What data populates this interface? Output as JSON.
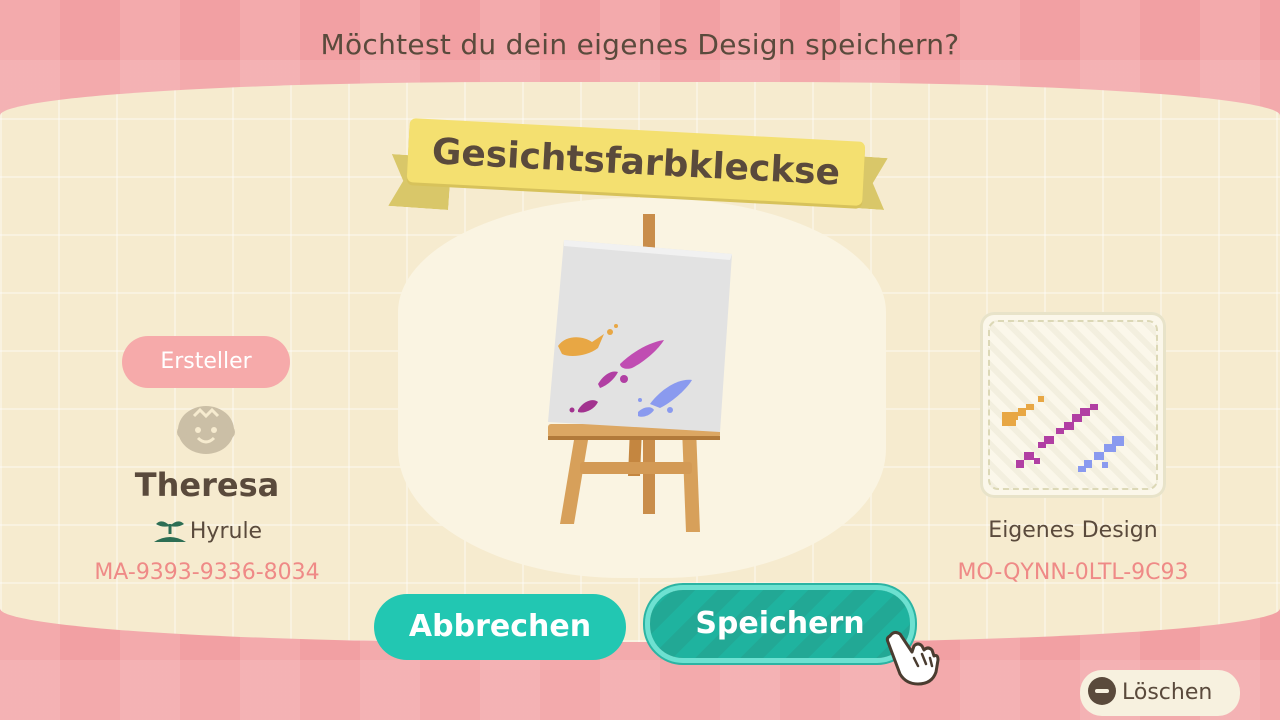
{
  "dialog": {
    "question": "Möchtest du dein eigenes Design speichern?",
    "design_title": "Gesichtsfarbkleckse"
  },
  "creator": {
    "tag": "Ersteller",
    "name": "Theresa",
    "island": "Hyrule",
    "code": "MA-9393-9336-8034"
  },
  "design": {
    "type": "Eigenes Design",
    "code": "MO-QYNN-0LTL-9C93"
  },
  "buttons": {
    "cancel": "Abbrechen",
    "save": "Speichern"
  },
  "footer": {
    "delete_label": "Löschen"
  },
  "colors": {
    "background_pink": "#f2a0a3",
    "cream": "#f6ebcf",
    "banner_yellow": "#f4e070",
    "teal": "#22c7b2",
    "code_pink": "#ef8a87",
    "text_brown": "#5a4a3c",
    "paint_orange": "#e8a744",
    "paint_magenta": "#b13fa3",
    "paint_blue": "#8a9aef"
  }
}
